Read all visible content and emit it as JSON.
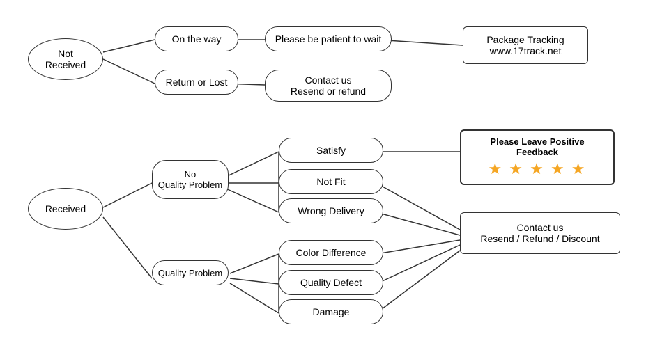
{
  "nodes": {
    "not_received": {
      "label": "Not\nReceived"
    },
    "on_the_way": {
      "label": "On the way"
    },
    "return_or_lost": {
      "label": "Return or Lost"
    },
    "patient": {
      "label": "Please be patient to wait"
    },
    "package_tracking": {
      "label": "Package Tracking\nwww.17track.net"
    },
    "contact_resend_refund": {
      "label": "Contact us\nResend or refund"
    },
    "received": {
      "label": "Received"
    },
    "no_quality_problem": {
      "label": "No\nQuality Problem"
    },
    "quality_problem": {
      "label": "Quality Problem"
    },
    "satisfy": {
      "label": "Satisfy"
    },
    "not_fit": {
      "label": "Not Fit"
    },
    "wrong_delivery": {
      "label": "Wrong Delivery"
    },
    "color_difference": {
      "label": "Color Difference"
    },
    "quality_defect": {
      "label": "Quality Defect"
    },
    "damage": {
      "label": "Damage"
    },
    "positive_feedback": {
      "label": "Please Leave Positive Feedback"
    },
    "stars": {
      "label": "★ ★ ★ ★ ★"
    },
    "contact_resend_refund_discount": {
      "label": "Contact us\nResend / Refund / Discount"
    }
  }
}
